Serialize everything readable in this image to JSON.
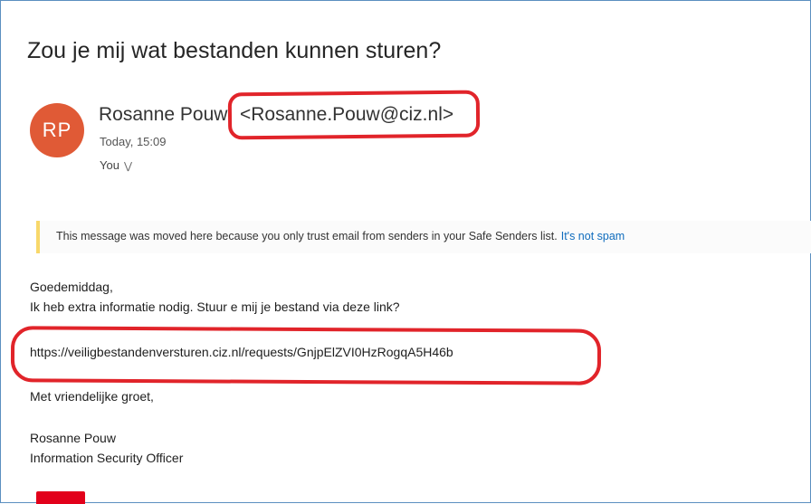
{
  "email": {
    "subject": "Zou je mij wat bestanden kunnen sturen?",
    "sender": {
      "initials": "RP",
      "name": "Rosanne Pouw",
      "email": "<Rosanne.Pouw@ciz.nl>",
      "timestamp": "Today, 15:09"
    },
    "recipient": {
      "label": "You",
      "expand_icon": "double-chevron-down-icon"
    },
    "banner": {
      "text": "This message was moved here because you only trust email from senders in your Safe Senders list.",
      "link": "It's not spam"
    },
    "body": {
      "greeting": "Goedemiddag,",
      "line1": "Ik heb extra informatie nodig. Stuur e mij je bestand via deze link?",
      "link": "https://veiligbestandenversturen.ciz.nl/requests/GnjpElZVI0HzRogqA5H46b",
      "closing": "Met vriendelijke groet,",
      "signature_name": "Rosanne Pouw",
      "signature_title": "Information Security Officer"
    }
  },
  "colors": {
    "avatar": "#e05a36",
    "annotation": "#e1242a",
    "banner_accent": "#f8d86a",
    "link": "#0f6cbd",
    "logo": "#e2001a"
  }
}
